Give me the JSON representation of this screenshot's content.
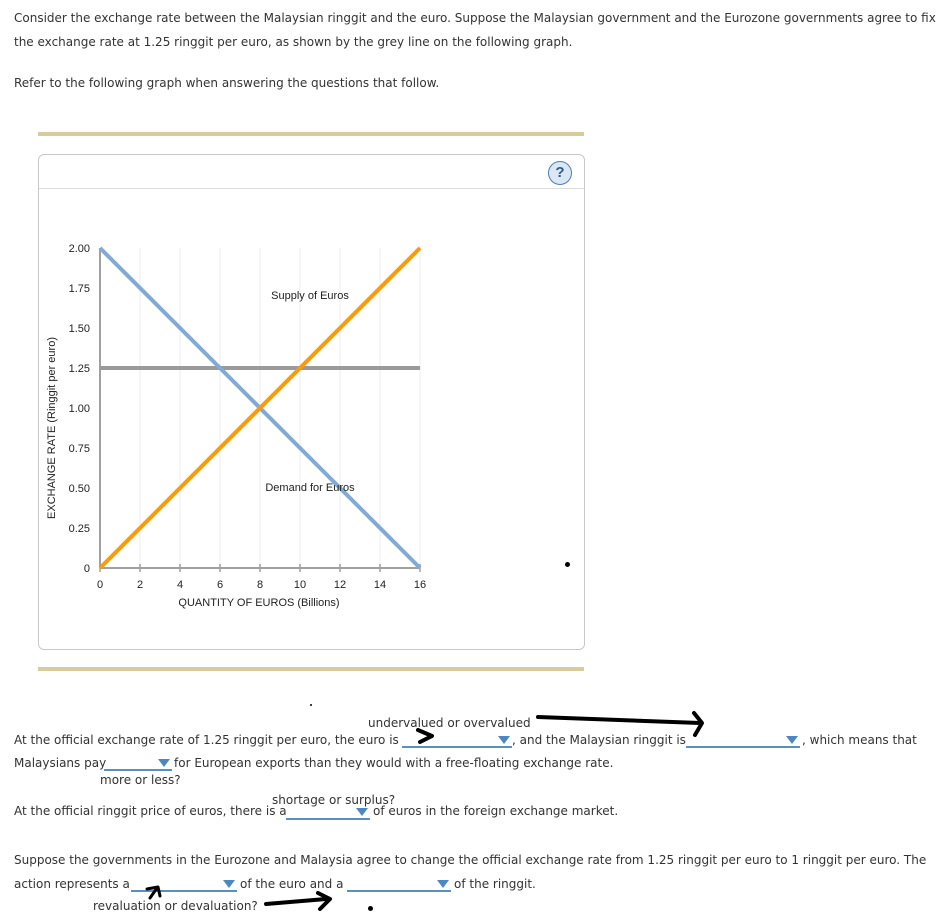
{
  "intro": {
    "line1": "Consider the exchange rate between the Malaysian ringgit and the euro. Suppose the Malaysian government and the Eurozone governments agree to fix",
    "line2": "the exchange rate at 1.25 ringgit per euro, as shown by the grey line on the following graph.",
    "refer": "Refer to the following graph when answering the questions that follow."
  },
  "help_label": "?",
  "chart_data": {
    "type": "line",
    "title": "",
    "xlabel": "QUANTITY OF EUROS (Billions)",
    "ylabel": "EXCHANGE RATE (Ringgit per euro)",
    "xlim": [
      0,
      16
    ],
    "ylim": [
      0,
      2.0
    ],
    "x_ticks": [
      0,
      2,
      4,
      6,
      8,
      10,
      12,
      14,
      16
    ],
    "y_ticks": [
      0,
      0.25,
      0.5,
      0.75,
      1.0,
      1.25,
      1.5,
      1.75,
      2.0
    ],
    "x_tick_labels": [
      "0",
      "2",
      "4",
      "6",
      "8",
      "10",
      "12",
      "14",
      "16"
    ],
    "y_tick_labels": [
      "0",
      "0.25",
      "0.50",
      "0.75",
      "1.00",
      "1.25",
      "1.50",
      "1.75",
      "2.00"
    ],
    "grid": "vertical",
    "series": [
      {
        "name": "Demand for Euros",
        "color": "#82aad4",
        "points": [
          [
            0,
            2.0
          ],
          [
            16,
            0
          ]
        ]
      },
      {
        "name": "Supply of Euros",
        "color": "#ff9a00",
        "points": [
          [
            0,
            0
          ],
          [
            16,
            2.0
          ]
        ]
      },
      {
        "name": "Fixed exchange rate",
        "color": "#9a9a9a",
        "points": [
          [
            0,
            1.25
          ],
          [
            16,
            1.25
          ]
        ]
      }
    ],
    "annotations": [
      {
        "text": "Supply of Euros",
        "x": 10.5,
        "y": 1.68
      },
      {
        "text": "Demand for Euros",
        "x": 10.5,
        "y": 0.48
      }
    ]
  },
  "q1": {
    "hint_top": "undervalued or overvalued",
    "text_a": "At the official exchange rate of 1.25 ringgit per euro, the euro is",
    "text_b": ", and the Malaysian ringgit is",
    "text_c": ", which means that",
    "text_d": "Malaysians pay",
    "text_e": "for European exports than they would with a free-floating exchange rate.",
    "hint_more": "more or less?",
    "dropdown_euro_value": "",
    "dropdown_ringgit_value": "",
    "dropdown_pay_value": ""
  },
  "q2": {
    "hint_top": "shortage or surplus?",
    "text_a": "At the official ringgit price of euros, there is a",
    "text_b": "of euros in the foreign exchange market.",
    "dropdown_value": ""
  },
  "q3": {
    "line1": "Suppose the governments in the Eurozone and Malaysia agree to change the official exchange rate from 1.25 ringgit per euro to 1 ringgit per euro. The",
    "text_a": "action represents a",
    "text_b": "of the euro and a",
    "text_c": "of the ringgit.",
    "hint_bottom": "revaluation or devaluation?",
    "dropdown_euro_value": "",
    "dropdown_ringgit_value": ""
  }
}
